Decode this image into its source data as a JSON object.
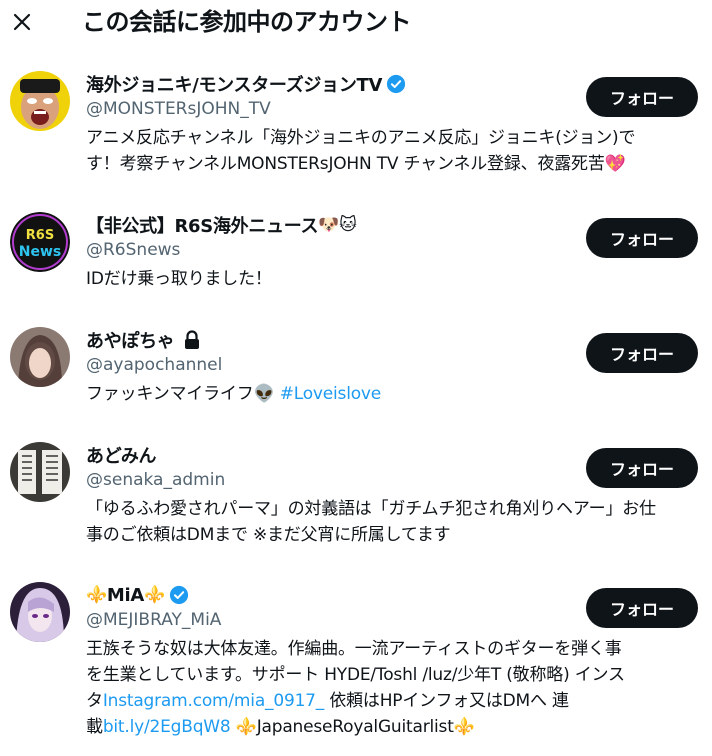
{
  "header": {
    "close_icon": "close-icon",
    "title": "この会話に参加中のアカウント"
  },
  "colors": {
    "text": "#0f1419",
    "secondary": "#536471",
    "accent": "#1d9bf0",
    "button_bg": "#0f1419"
  },
  "users": [
    {
      "name": "海外ジョニキ/モンスターズジョンTV",
      "handle": "@MONSTERsJOHN_TV",
      "verified": true,
      "follow_label": "フォロー",
      "bio_line1": "アニメ反応チャンネル「海外ジョニキのアニメ反応」ジョニキ(ジョン)で",
      "bio_line2": "す！考察チャンネルMONSTERsJOHN TV チャンネル登録、夜露死苦",
      "bio_emoji": "💖"
    },
    {
      "name": "【非公式】R6S海外ニュース",
      "name_emoji": "🐶🐱",
      "handle": "@R6Snews",
      "follow_label": "フォロー",
      "bio_line1": "IDだけ乗っ取りました！",
      "avatar_text_top": "R6S",
      "avatar_text_bottom": "News"
    },
    {
      "name": "あやぽちゃ",
      "locked": true,
      "handle": "@ayapochannel",
      "follow_label": "フォロー",
      "bio_text": "ファッキンマイライフ",
      "bio_emoji": "👽",
      "bio_hashtag": "#Loveislove"
    },
    {
      "name": "あどみん",
      "handle": "@senaka_admin",
      "follow_label": "フォロー",
      "bio_line1": "「ゆるふわ愛されパーマ」の対義語は「ガチムチ犯され角刈りヘアー」お仕",
      "bio_line2": "事のご依頼はDMまで ※まだ父宵に所属してます"
    },
    {
      "name": "MiA",
      "name_emoji_left": "⚜️",
      "name_emoji_right": "⚜️",
      "verified": true,
      "handle": "@MEJIBRAY_MiA",
      "follow_label": "フォロー",
      "bio_line1": "王族そうな奴は大体友達。作編曲。一流アーティストのギターを弾く事",
      "bio_line2": "を生業としています。サポート HYDE/Toshl /luz/少年T (敬称略) インス",
      "bio_line3_a": "タ",
      "bio_line3_link": "Instagram.com/mia_0917_",
      "bio_line3_b": " 依頼はHPインフォ又はDMへ 連",
      "bio_line4_a": "載",
      "bio_line4_link": "bit.ly/2EgBqW8",
      "bio_line4_emoji_a": " ⚜️",
      "bio_line4_text": "JapaneseRoyalGuitarlist",
      "bio_line4_emoji_b": "⚜️"
    }
  ]
}
